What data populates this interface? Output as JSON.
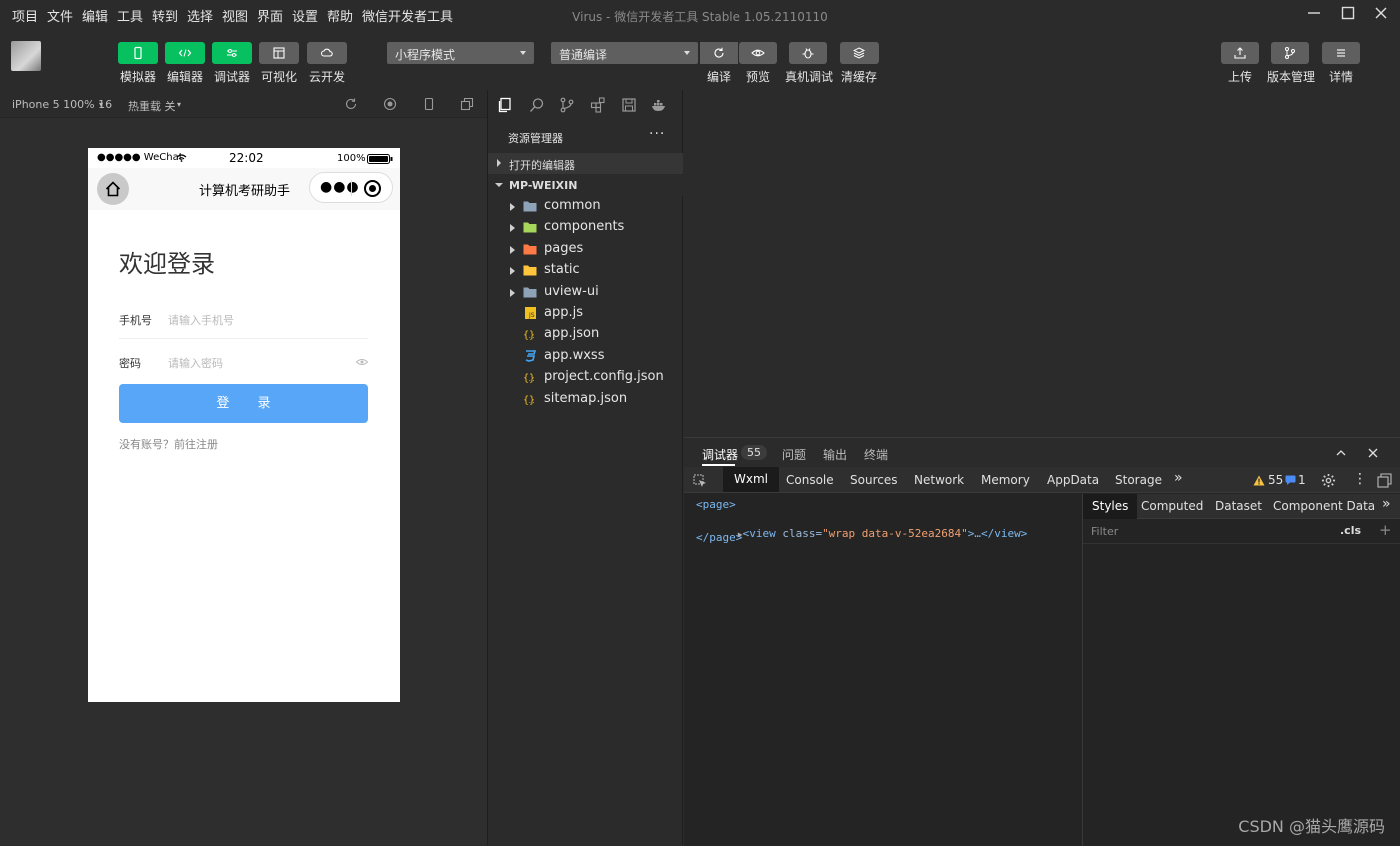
{
  "menu": {
    "items": [
      "项目",
      "文件",
      "编辑",
      "工具",
      "转到",
      "选择",
      "视图",
      "界面",
      "设置",
      "帮助",
      "微信开发者工具"
    ],
    "title": "Virus - 微信开发者工具 Stable 1.05.2110110"
  },
  "toolbar": {
    "simulator": "模拟器",
    "editor": "编辑器",
    "debugger": "调试器",
    "visualize": "可视化",
    "cloud": "云开发",
    "mode_select": "小程序模式",
    "compile_select": "普通编译",
    "compile": "编译",
    "preview": "预览",
    "real_debug": "真机调试",
    "clear_cache": "清缓存",
    "upload": "上传",
    "version": "版本管理",
    "details": "详情"
  },
  "simbar": {
    "device": "iPhone 5 100% 16",
    "hot_reload": "热重载 关"
  },
  "phone": {
    "carrier": "●●●●● WeChat",
    "time": "22:02",
    "battery": "100%",
    "nav_title": "计算机考研助手",
    "login_title": "欢迎登录",
    "phone_label": "手机号",
    "phone_placeholder": "请输入手机号",
    "pwd_label": "密码",
    "pwd_placeholder": "请输入密码",
    "login_button": "登 录",
    "register_link": "没有账号？前往注册"
  },
  "explorer": {
    "header": "资源管理器",
    "open_editors": "打开的编辑器",
    "project": "MP-WEIXIN",
    "items": [
      {
        "name": "common",
        "type": "folder"
      },
      {
        "name": "components",
        "type": "folder"
      },
      {
        "name": "pages",
        "type": "folder"
      },
      {
        "name": "static",
        "type": "folder"
      },
      {
        "name": "uview-ui",
        "type": "folder"
      },
      {
        "name": "app.js",
        "type": "js"
      },
      {
        "name": "app.json",
        "type": "json"
      },
      {
        "name": "app.wxss",
        "type": "css"
      },
      {
        "name": "project.config.json",
        "type": "json"
      },
      {
        "name": "sitemap.json",
        "type": "json"
      }
    ]
  },
  "debugger": {
    "tabs": {
      "debug": "调试器",
      "debug_count": "55",
      "issues": "问题",
      "output": "输出",
      "terminal": "终端"
    },
    "dev_tabs": [
      "Wxml",
      "Console",
      "Sources",
      "Network",
      "Memory",
      "AppData",
      "Storage"
    ],
    "warn_count": "55",
    "info_count": "1",
    "code": {
      "line1": "<page>",
      "view_open": "<view",
      "attr_name": " class=",
      "attr_value": "\"wrap data-v-52ea2684\"",
      "view_close": ">…</view>",
      "line3": "</page>"
    },
    "styles_tabs": [
      "Styles",
      "Computed",
      "Dataset",
      "Component Data"
    ],
    "filter_placeholder": "Filter",
    "cls": ".cls",
    "plus": "+"
  },
  "watermark": "CSDN @猫头鹰源码",
  "colors": {
    "accent_green": "#07c160",
    "login_button": "#58a6f8",
    "folder": "#8fa3b8",
    "components_folder": "#a6d65a",
    "pages_folder": "#ff7a45",
    "static_folder": "#ffc53d",
    "js": "#f0c020",
    "json": "#f0c020",
    "css": "#42a5f5"
  }
}
